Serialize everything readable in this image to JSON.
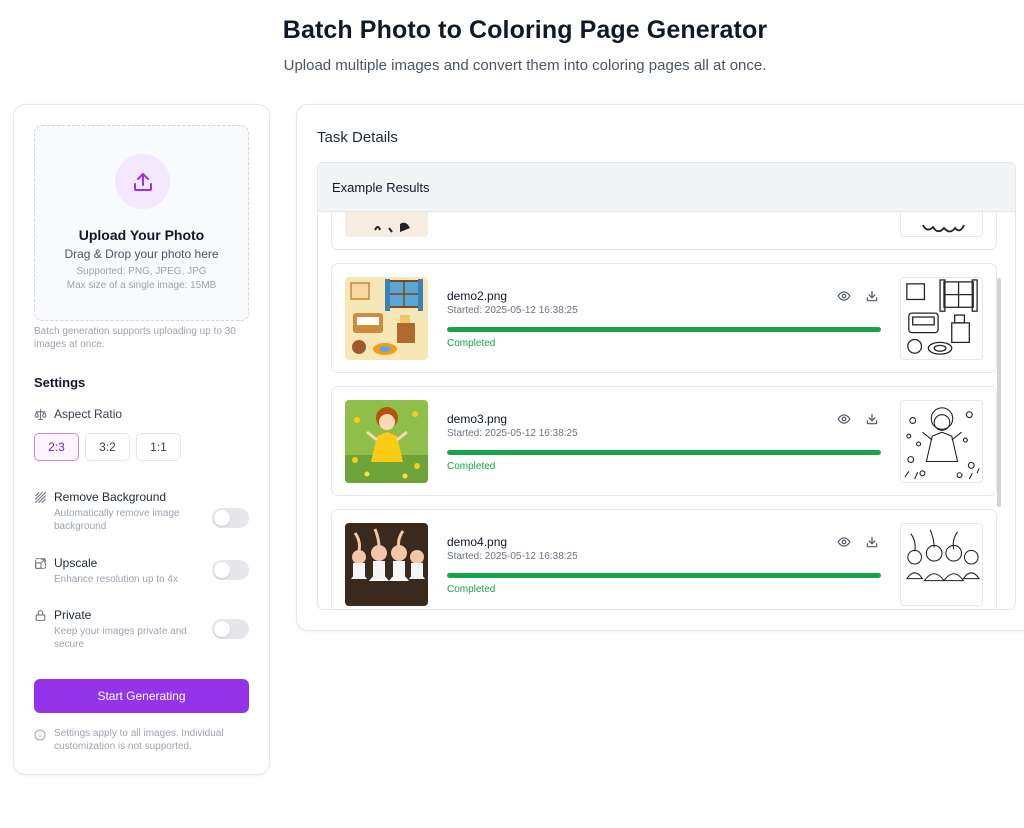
{
  "header": {
    "title": "Batch Photo to Coloring Page Generator",
    "subtitle": "Upload multiple images and convert them into coloring pages all at once."
  },
  "upload": {
    "icon": "upload-icon",
    "title": "Upload Your Photo",
    "drag_text": "Drag & Drop your photo here",
    "supported": "Supported: PNG, JPEG, JPG",
    "max_size": "Max size of a single image: 15MB",
    "batch_note": "Batch generation supports uploading up to 30 images at once."
  },
  "settings": {
    "title": "Settings",
    "aspect_ratio": {
      "label": "Aspect Ratio",
      "options": [
        "2:3",
        "3:2",
        "1:1"
      ],
      "selected": "2:3"
    },
    "remove_background": {
      "label": "Remove Background",
      "description": "Automatically remove image background",
      "enabled": false
    },
    "upscale": {
      "label": "Upscale",
      "description": "Enhance resolution up to 4x",
      "enabled": false
    },
    "private": {
      "label": "Private",
      "description": "Keep your images private and secure",
      "enabled": false
    },
    "start_button": "Start Generating",
    "footnote": "Settings apply to all images. Individual customization is not supported."
  },
  "tasks": {
    "title": "Task Details",
    "results_header": "Example Results",
    "items": [
      {
        "name": "demo2.png",
        "started": "Started: 2025-05-12 16:38:25",
        "progress": 1.0,
        "status": "Completed"
      },
      {
        "name": "demo3.png",
        "started": "Started: 2025-05-12 16:38:25",
        "progress": 1.0,
        "status": "Completed"
      },
      {
        "name": "demo4.png",
        "started": "Started: 2025-05-12 16:38:25",
        "progress": 1.0,
        "status": "Completed"
      }
    ]
  },
  "colors": {
    "accent": "#9333ea",
    "accent_light": "#f3e8ff",
    "success": "#16a34a"
  }
}
